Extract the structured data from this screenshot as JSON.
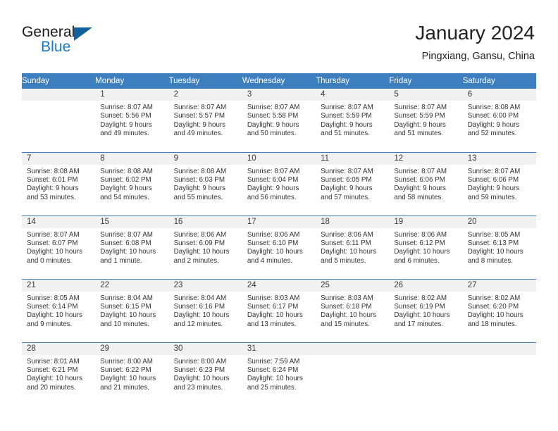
{
  "brand": {
    "name_part1": "General",
    "name_part2": "Blue",
    "triangle_icon": "triangle-icon"
  },
  "header": {
    "title": "January 2024",
    "location": "Pingxiang, Gansu, China"
  },
  "colors": {
    "header_blue": "#3d7ebf",
    "logo_blue": "#1878c8",
    "daynum_bg": "#f1f1f1",
    "text": "#333333"
  },
  "weekdays": [
    "Sunday",
    "Monday",
    "Tuesday",
    "Wednesday",
    "Thursday",
    "Friday",
    "Saturday"
  ],
  "weeks": [
    [
      {
        "day": "",
        "sunrise": "",
        "sunset": "",
        "daylight_line1": "",
        "daylight_line2": ""
      },
      {
        "day": "1",
        "sunrise": "Sunrise: 8:07 AM",
        "sunset": "Sunset: 5:56 PM",
        "daylight_line1": "Daylight: 9 hours",
        "daylight_line2": "and 49 minutes."
      },
      {
        "day": "2",
        "sunrise": "Sunrise: 8:07 AM",
        "sunset": "Sunset: 5:57 PM",
        "daylight_line1": "Daylight: 9 hours",
        "daylight_line2": "and 49 minutes."
      },
      {
        "day": "3",
        "sunrise": "Sunrise: 8:07 AM",
        "sunset": "Sunset: 5:58 PM",
        "daylight_line1": "Daylight: 9 hours",
        "daylight_line2": "and 50 minutes."
      },
      {
        "day": "4",
        "sunrise": "Sunrise: 8:07 AM",
        "sunset": "Sunset: 5:59 PM",
        "daylight_line1": "Daylight: 9 hours",
        "daylight_line2": "and 51 minutes."
      },
      {
        "day": "5",
        "sunrise": "Sunrise: 8:07 AM",
        "sunset": "Sunset: 5:59 PM",
        "daylight_line1": "Daylight: 9 hours",
        "daylight_line2": "and 51 minutes."
      },
      {
        "day": "6",
        "sunrise": "Sunrise: 8:08 AM",
        "sunset": "Sunset: 6:00 PM",
        "daylight_line1": "Daylight: 9 hours",
        "daylight_line2": "and 52 minutes."
      }
    ],
    [
      {
        "day": "7",
        "sunrise": "Sunrise: 8:08 AM",
        "sunset": "Sunset: 6:01 PM",
        "daylight_line1": "Daylight: 9 hours",
        "daylight_line2": "and 53 minutes."
      },
      {
        "day": "8",
        "sunrise": "Sunrise: 8:08 AM",
        "sunset": "Sunset: 6:02 PM",
        "daylight_line1": "Daylight: 9 hours",
        "daylight_line2": "and 54 minutes."
      },
      {
        "day": "9",
        "sunrise": "Sunrise: 8:08 AM",
        "sunset": "Sunset: 6:03 PM",
        "daylight_line1": "Daylight: 9 hours",
        "daylight_line2": "and 55 minutes."
      },
      {
        "day": "10",
        "sunrise": "Sunrise: 8:07 AM",
        "sunset": "Sunset: 6:04 PM",
        "daylight_line1": "Daylight: 9 hours",
        "daylight_line2": "and 56 minutes."
      },
      {
        "day": "11",
        "sunrise": "Sunrise: 8:07 AM",
        "sunset": "Sunset: 6:05 PM",
        "daylight_line1": "Daylight: 9 hours",
        "daylight_line2": "and 57 minutes."
      },
      {
        "day": "12",
        "sunrise": "Sunrise: 8:07 AM",
        "sunset": "Sunset: 6:06 PM",
        "daylight_line1": "Daylight: 9 hours",
        "daylight_line2": "and 58 minutes."
      },
      {
        "day": "13",
        "sunrise": "Sunrise: 8:07 AM",
        "sunset": "Sunset: 6:06 PM",
        "daylight_line1": "Daylight: 9 hours",
        "daylight_line2": "and 59 minutes."
      }
    ],
    [
      {
        "day": "14",
        "sunrise": "Sunrise: 8:07 AM",
        "sunset": "Sunset: 6:07 PM",
        "daylight_line1": "Daylight: 10 hours",
        "daylight_line2": "and 0 minutes."
      },
      {
        "day": "15",
        "sunrise": "Sunrise: 8:07 AM",
        "sunset": "Sunset: 6:08 PM",
        "daylight_line1": "Daylight: 10 hours",
        "daylight_line2": "and 1 minute."
      },
      {
        "day": "16",
        "sunrise": "Sunrise: 8:06 AM",
        "sunset": "Sunset: 6:09 PM",
        "daylight_line1": "Daylight: 10 hours",
        "daylight_line2": "and 2 minutes."
      },
      {
        "day": "17",
        "sunrise": "Sunrise: 8:06 AM",
        "sunset": "Sunset: 6:10 PM",
        "daylight_line1": "Daylight: 10 hours",
        "daylight_line2": "and 4 minutes."
      },
      {
        "day": "18",
        "sunrise": "Sunrise: 8:06 AM",
        "sunset": "Sunset: 6:11 PM",
        "daylight_line1": "Daylight: 10 hours",
        "daylight_line2": "and 5 minutes."
      },
      {
        "day": "19",
        "sunrise": "Sunrise: 8:06 AM",
        "sunset": "Sunset: 6:12 PM",
        "daylight_line1": "Daylight: 10 hours",
        "daylight_line2": "and 6 minutes."
      },
      {
        "day": "20",
        "sunrise": "Sunrise: 8:05 AM",
        "sunset": "Sunset: 6:13 PM",
        "daylight_line1": "Daylight: 10 hours",
        "daylight_line2": "and 8 minutes."
      }
    ],
    [
      {
        "day": "21",
        "sunrise": "Sunrise: 8:05 AM",
        "sunset": "Sunset: 6:14 PM",
        "daylight_line1": "Daylight: 10 hours",
        "daylight_line2": "and 9 minutes."
      },
      {
        "day": "22",
        "sunrise": "Sunrise: 8:04 AM",
        "sunset": "Sunset: 6:15 PM",
        "daylight_line1": "Daylight: 10 hours",
        "daylight_line2": "and 10 minutes."
      },
      {
        "day": "23",
        "sunrise": "Sunrise: 8:04 AM",
        "sunset": "Sunset: 6:16 PM",
        "daylight_line1": "Daylight: 10 hours",
        "daylight_line2": "and 12 minutes."
      },
      {
        "day": "24",
        "sunrise": "Sunrise: 8:03 AM",
        "sunset": "Sunset: 6:17 PM",
        "daylight_line1": "Daylight: 10 hours",
        "daylight_line2": "and 13 minutes."
      },
      {
        "day": "25",
        "sunrise": "Sunrise: 8:03 AM",
        "sunset": "Sunset: 6:18 PM",
        "daylight_line1": "Daylight: 10 hours",
        "daylight_line2": "and 15 minutes."
      },
      {
        "day": "26",
        "sunrise": "Sunrise: 8:02 AM",
        "sunset": "Sunset: 6:19 PM",
        "daylight_line1": "Daylight: 10 hours",
        "daylight_line2": "and 17 minutes."
      },
      {
        "day": "27",
        "sunrise": "Sunrise: 8:02 AM",
        "sunset": "Sunset: 6:20 PM",
        "daylight_line1": "Daylight: 10 hours",
        "daylight_line2": "and 18 minutes."
      }
    ],
    [
      {
        "day": "28",
        "sunrise": "Sunrise: 8:01 AM",
        "sunset": "Sunset: 6:21 PM",
        "daylight_line1": "Daylight: 10 hours",
        "daylight_line2": "and 20 minutes."
      },
      {
        "day": "29",
        "sunrise": "Sunrise: 8:00 AM",
        "sunset": "Sunset: 6:22 PM",
        "daylight_line1": "Daylight: 10 hours",
        "daylight_line2": "and 21 minutes."
      },
      {
        "day": "30",
        "sunrise": "Sunrise: 8:00 AM",
        "sunset": "Sunset: 6:23 PM",
        "daylight_line1": "Daylight: 10 hours",
        "daylight_line2": "and 23 minutes."
      },
      {
        "day": "31",
        "sunrise": "Sunrise: 7:59 AM",
        "sunset": "Sunset: 6:24 PM",
        "daylight_line1": "Daylight: 10 hours",
        "daylight_line2": "and 25 minutes."
      },
      {
        "day": "",
        "sunrise": "",
        "sunset": "",
        "daylight_line1": "",
        "daylight_line2": ""
      },
      {
        "day": "",
        "sunrise": "",
        "sunset": "",
        "daylight_line1": "",
        "daylight_line2": ""
      },
      {
        "day": "",
        "sunrise": "",
        "sunset": "",
        "daylight_line1": "",
        "daylight_line2": ""
      }
    ]
  ]
}
